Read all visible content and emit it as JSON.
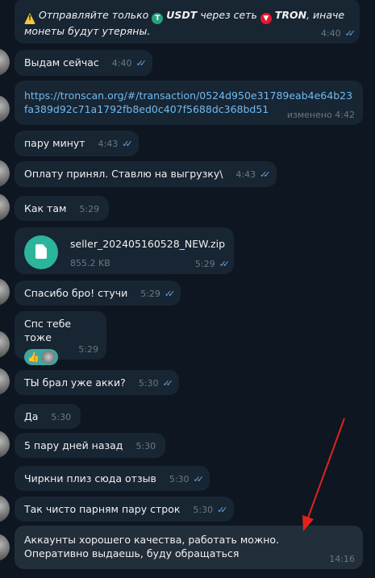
{
  "messages": {
    "m1": {
      "warning_part1": "Отправляйте только",
      "usdt": "USDT",
      "warning_part2": "через сеть",
      "tron": "TRON",
      "warning_part3": ", иначе",
      "warning_line2": "монеты будут утеряны.",
      "time": "4:40"
    },
    "m2": {
      "text": "Выдам сейчас",
      "time": "4:40"
    },
    "m3": {
      "link": "https://tronscan.org/#/transaction/0524d950e31789eab4e64b23fa389d92c71a1792fb8ed0c407f5688dc368bd51",
      "edited": "изменено 4:42"
    },
    "m4": {
      "text": "пару минут",
      "time": "4:43"
    },
    "m5": {
      "text": "Оплату принял. Ставлю на выгрузку\\",
      "time": "4:43"
    },
    "m6": {
      "text": "Как там",
      "time": "5:29"
    },
    "m7": {
      "filename": "seller_202405160528_NEW.zip",
      "size": "855.2 KB",
      "time": "5:29"
    },
    "m8": {
      "text": "Спасибо бро! стучи",
      "time": "5:29"
    },
    "m9": {
      "text": "Спс тебе тоже",
      "reaction": "👍",
      "time": "5:29"
    },
    "m10": {
      "text": "ТЫ брал уже акки?",
      "time": "5:30"
    },
    "m11": {
      "text": "Да",
      "time": "5:30"
    },
    "m12": {
      "text": "5 пару дней назад",
      "time": "5:30"
    },
    "m13": {
      "text": "Чиркни плиз сюда отзыв",
      "time": "5:30"
    },
    "m14": {
      "text": "Так чисто парням пару строк",
      "time": "5:30"
    },
    "m15": {
      "text": "Аккаунты хорошего качества, работать можно. Оперативно выдаешь, буду обращаться",
      "time": "14:16"
    }
  },
  "colors": {
    "background": "#0e1621",
    "bubble": "#182533",
    "accent": "#62a5e0",
    "arrow": "#e0241d"
  }
}
